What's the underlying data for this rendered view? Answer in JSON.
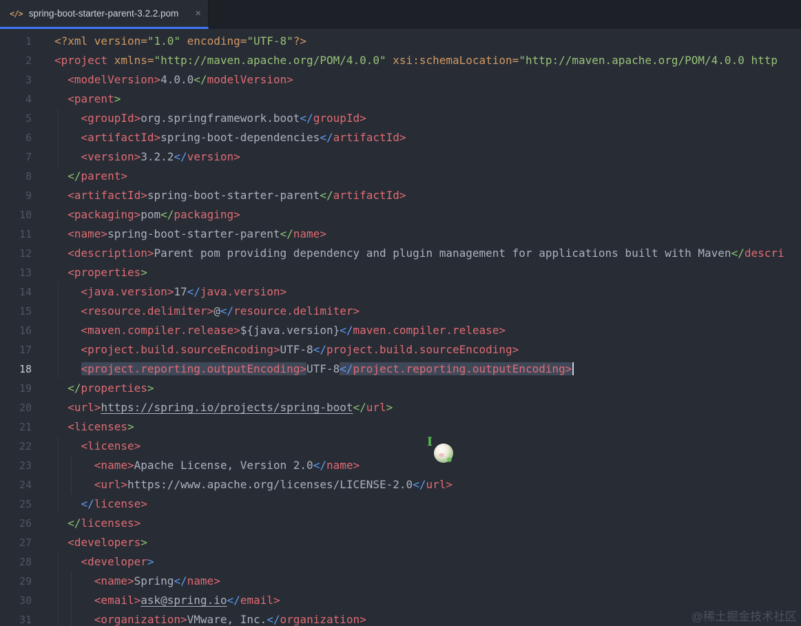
{
  "tab": {
    "icon": "</>",
    "title": "spring-boot-starter-parent-3.2.2.pom",
    "close": "×"
  },
  "colors": {
    "bg": "#282c34",
    "tabbar": "#1d2127",
    "accent": "#3e76f7",
    "tag": "#e06c75",
    "attr": "#d19a66",
    "str": "#98c379",
    "txt": "#abb2bf",
    "grn": "#8cc573",
    "blu": "#5c9cf5",
    "lnum": "#4f5662",
    "sel": "rgba(120,140,175,0.30)",
    "wm": "#4b515c"
  },
  "cursor": {
    "ibeam": "I"
  },
  "watermark": {
    "text": "@稀土掘金技术社区"
  },
  "editor": {
    "lines": [
      {
        "n": 1,
        "ind": 0,
        "tk": [
          [
            "<?xml version=",
            "attr"
          ],
          [
            "\"1.0\"",
            "str"
          ],
          [
            " encoding=",
            "attr"
          ],
          [
            "\"UTF-8\"",
            "str"
          ],
          [
            "?>",
            "attr"
          ]
        ]
      },
      {
        "n": 2,
        "ind": 0,
        "tk": [
          [
            "<project",
            "tag"
          ],
          [
            " xmlns=",
            "attr"
          ],
          [
            "\"http://maven.apache.org/POM/4.0.0\"",
            "str"
          ],
          [
            " xsi:schemaLocation=",
            "attr"
          ],
          [
            "\"http://maven.apache.org/POM/4.0.0 http",
            "str"
          ]
        ]
      },
      {
        "n": 3,
        "ind": 2,
        "tk": [
          [
            "<modelVersion>",
            "tag"
          ],
          [
            "4.0.0",
            "txt"
          ],
          [
            "</",
            "grn"
          ],
          [
            "modelVersion>",
            "tag"
          ]
        ]
      },
      {
        "n": 4,
        "ind": 2,
        "tk": [
          [
            "<parent",
            "tag"
          ],
          [
            ">",
            "grn"
          ]
        ]
      },
      {
        "n": 5,
        "ind": 4,
        "tk": [
          [
            "<groupId>",
            "tag"
          ],
          [
            "org.springframework.boot",
            "txt"
          ],
          [
            "</",
            "blu"
          ],
          [
            "groupId>",
            "tag"
          ]
        ]
      },
      {
        "n": 6,
        "ind": 4,
        "tk": [
          [
            "<artifactId>",
            "tag"
          ],
          [
            "spring-boot-dependencies",
            "txt"
          ],
          [
            "</",
            "blu"
          ],
          [
            "artifactId>",
            "tag"
          ]
        ]
      },
      {
        "n": 7,
        "ind": 4,
        "tk": [
          [
            "<version>",
            "tag"
          ],
          [
            "3.2.2",
            "txt"
          ],
          [
            "</",
            "blu"
          ],
          [
            "version>",
            "tag"
          ]
        ]
      },
      {
        "n": 8,
        "ind": 2,
        "tk": [
          [
            "</",
            "grn"
          ],
          [
            "parent>",
            "tag"
          ]
        ]
      },
      {
        "n": 9,
        "ind": 2,
        "tk": [
          [
            "<artifactId>",
            "tag"
          ],
          [
            "spring-boot-starter-parent",
            "txt"
          ],
          [
            "</",
            "grn"
          ],
          [
            "artifactId>",
            "tag"
          ]
        ]
      },
      {
        "n": 10,
        "ind": 2,
        "tk": [
          [
            "<packaging>",
            "tag"
          ],
          [
            "pom",
            "txt"
          ],
          [
            "</",
            "grn"
          ],
          [
            "packaging>",
            "tag"
          ]
        ]
      },
      {
        "n": 11,
        "ind": 2,
        "tk": [
          [
            "<name>",
            "tag"
          ],
          [
            "spring-boot-starter-parent",
            "txt"
          ],
          [
            "</",
            "grn"
          ],
          [
            "name>",
            "tag"
          ]
        ]
      },
      {
        "n": 12,
        "ind": 2,
        "tk": [
          [
            "<description>",
            "tag"
          ],
          [
            "Parent pom providing dependency and plugin management for applications built with Maven",
            "txt"
          ],
          [
            "</",
            "grn"
          ],
          [
            "descri",
            "tag"
          ]
        ]
      },
      {
        "n": 13,
        "ind": 2,
        "tk": [
          [
            "<properties",
            "tag"
          ],
          [
            ">",
            "grn"
          ]
        ]
      },
      {
        "n": 14,
        "ind": 4,
        "tk": [
          [
            "<java.version>",
            "tag"
          ],
          [
            "17",
            "txt"
          ],
          [
            "</",
            "blu"
          ],
          [
            "java.version>",
            "tag"
          ]
        ]
      },
      {
        "n": 15,
        "ind": 4,
        "tk": [
          [
            "<resource.delimiter>",
            "tag"
          ],
          [
            "@",
            "txt"
          ],
          [
            "</",
            "blu"
          ],
          [
            "resource.delimiter>",
            "tag"
          ]
        ]
      },
      {
        "n": 16,
        "ind": 4,
        "tk": [
          [
            "<maven.compiler.release>",
            "tag"
          ],
          [
            "${java.version}",
            "txt"
          ],
          [
            "</",
            "blu"
          ],
          [
            "maven.compiler.release>",
            "tag"
          ]
        ]
      },
      {
        "n": 17,
        "ind": 4,
        "tk": [
          [
            "<project.build.sourceEncoding>",
            "tag"
          ],
          [
            "UTF-8",
            "txt"
          ],
          [
            "</",
            "blu"
          ],
          [
            "project.build.sourceEncoding>",
            "tag"
          ]
        ]
      },
      {
        "n": 18,
        "ind": 4,
        "caret": true,
        "tk": [
          [
            "<project.reporting.outputEncoding>",
            "tag",
            true
          ],
          [
            "UTF-8",
            "txt"
          ],
          [
            "</",
            "blu",
            true
          ],
          [
            "project.reporting.outputEncoding>",
            "tag",
            true
          ]
        ]
      },
      {
        "n": 19,
        "ind": 2,
        "tk": [
          [
            "</",
            "grn"
          ],
          [
            "properties",
            "tag"
          ],
          [
            ">",
            "grn"
          ]
        ]
      },
      {
        "n": 20,
        "ind": 2,
        "tk": [
          [
            "<url>",
            "tag"
          ],
          [
            "https://spring.io/projects/spring-boot",
            "lnk"
          ],
          [
            "</",
            "grn"
          ],
          [
            "url",
            "tag"
          ],
          [
            ">",
            "grn"
          ]
        ]
      },
      {
        "n": 21,
        "ind": 2,
        "tk": [
          [
            "<licenses",
            "tag"
          ],
          [
            ">",
            "grn"
          ]
        ]
      },
      {
        "n": 22,
        "ind": 4,
        "tk": [
          [
            "<license>",
            "tag"
          ]
        ]
      },
      {
        "n": 23,
        "ind": 6,
        "tk": [
          [
            "<name>",
            "tag"
          ],
          [
            "Apache License, Version 2.0",
            "txt"
          ],
          [
            "</",
            "blu"
          ],
          [
            "name>",
            "tag"
          ]
        ]
      },
      {
        "n": 24,
        "ind": 6,
        "tk": [
          [
            "<url>",
            "tag"
          ],
          [
            "https://www.apache.org/licenses/LICENSE-2.0",
            "txt"
          ],
          [
            "</",
            "blu"
          ],
          [
            "url>",
            "tag"
          ]
        ]
      },
      {
        "n": 25,
        "ind": 4,
        "tk": [
          [
            "</",
            "blu"
          ],
          [
            "license>",
            "tag"
          ]
        ]
      },
      {
        "n": 26,
        "ind": 2,
        "tk": [
          [
            "</",
            "grn"
          ],
          [
            "licenses>",
            "tag"
          ]
        ]
      },
      {
        "n": 27,
        "ind": 2,
        "tk": [
          [
            "<developers",
            "tag"
          ],
          [
            ">",
            "grn"
          ]
        ]
      },
      {
        "n": 28,
        "ind": 4,
        "tk": [
          [
            "<developer",
            "tag"
          ],
          [
            ">",
            "blu"
          ]
        ]
      },
      {
        "n": 29,
        "ind": 6,
        "tk": [
          [
            "<name>",
            "tag"
          ],
          [
            "Spring",
            "txt"
          ],
          [
            "</",
            "blu"
          ],
          [
            "name>",
            "tag"
          ]
        ]
      },
      {
        "n": 30,
        "ind": 6,
        "tk": [
          [
            "<email>",
            "tag"
          ],
          [
            "ask@spring.io",
            "lnk"
          ],
          [
            "</",
            "blu"
          ],
          [
            "email>",
            "tag"
          ]
        ]
      },
      {
        "n": 31,
        "ind": 6,
        "tk": [
          [
            "<organization>",
            "tag"
          ],
          [
            "VMware,",
            "sqg"
          ],
          [
            " Inc.",
            "txt"
          ],
          [
            "</",
            "blu"
          ],
          [
            "organization>",
            "tag"
          ]
        ]
      }
    ]
  }
}
